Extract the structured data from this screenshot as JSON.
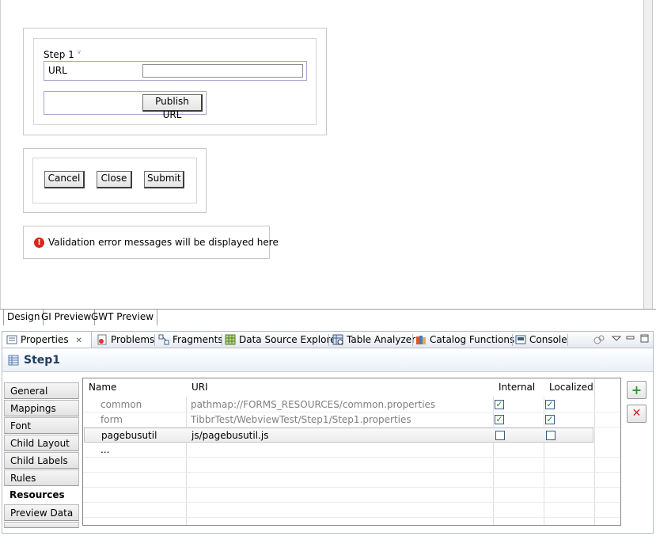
{
  "design": {
    "step_label": "Step 1",
    "url_label": "URL",
    "url_value": "",
    "publish_button": "Publish URL",
    "cancel_button": "Cancel",
    "close_button": "Close",
    "submit_button": "Submit",
    "validation_icon": "error-icon",
    "validation_text": "Validation error messages will be displayed here"
  },
  "editor_tabs": [
    {
      "label": "Design",
      "active": true
    },
    {
      "label": "GI Preview",
      "active": false
    },
    {
      "label": "GWT Preview",
      "active": false
    }
  ],
  "views_tabs": [
    {
      "label": "Properties",
      "icon": "properties-icon",
      "active": true,
      "close": "✕"
    },
    {
      "label": "Problems",
      "icon": "problems-icon",
      "active": false
    },
    {
      "label": "Fragments",
      "icon": "fragments-icon",
      "active": false
    },
    {
      "label": "Data Source Explorer",
      "icon": "data-source-icon",
      "active": false
    },
    {
      "label": "Table Analyzer",
      "icon": "table-analyzer-icon",
      "active": false
    },
    {
      "label": "Catalog Functions",
      "icon": "catalog-icon",
      "active": false
    },
    {
      "label": "Console",
      "icon": "console-icon",
      "active": false
    }
  ],
  "properties": {
    "title": "Step1",
    "title_icon": "table-icon",
    "side_tabs": [
      {
        "label": "General",
        "active": false
      },
      {
        "label": "Mappings",
        "active": false
      },
      {
        "label": "Font",
        "active": false
      },
      {
        "label": "Child Layout",
        "active": false
      },
      {
        "label": "Child Labels",
        "active": false
      },
      {
        "label": "Rules",
        "active": false
      },
      {
        "label": "Resources",
        "active": true
      },
      {
        "label": "Preview Data",
        "active": false
      }
    ],
    "table": {
      "headers": [
        "Name",
        "URI",
        "Internal",
        "Localized"
      ],
      "rows": [
        {
          "name": "common",
          "uri": "pathmap://FORMS_RESOURCES/common.properties",
          "internal": true,
          "localized": true,
          "grayed": true
        },
        {
          "name": "form",
          "uri": "TibbrTest/WebviewTest/Step1/Step1.properties",
          "internal": true,
          "localized": true,
          "grayed": true
        },
        {
          "name": "pagebusutil",
          "uri": "js/pagebusutil.js",
          "internal": false,
          "localized": false,
          "grayed": false
        },
        {
          "name": "...",
          "uri": "",
          "internal": null,
          "localized": null,
          "grayed": false
        }
      ]
    },
    "add_button": "+",
    "remove_button": "✕"
  },
  "colors": {
    "add_green": "#2e9a2e",
    "remove_red": "#cc2222",
    "title_blue": "#1f3d63"
  }
}
